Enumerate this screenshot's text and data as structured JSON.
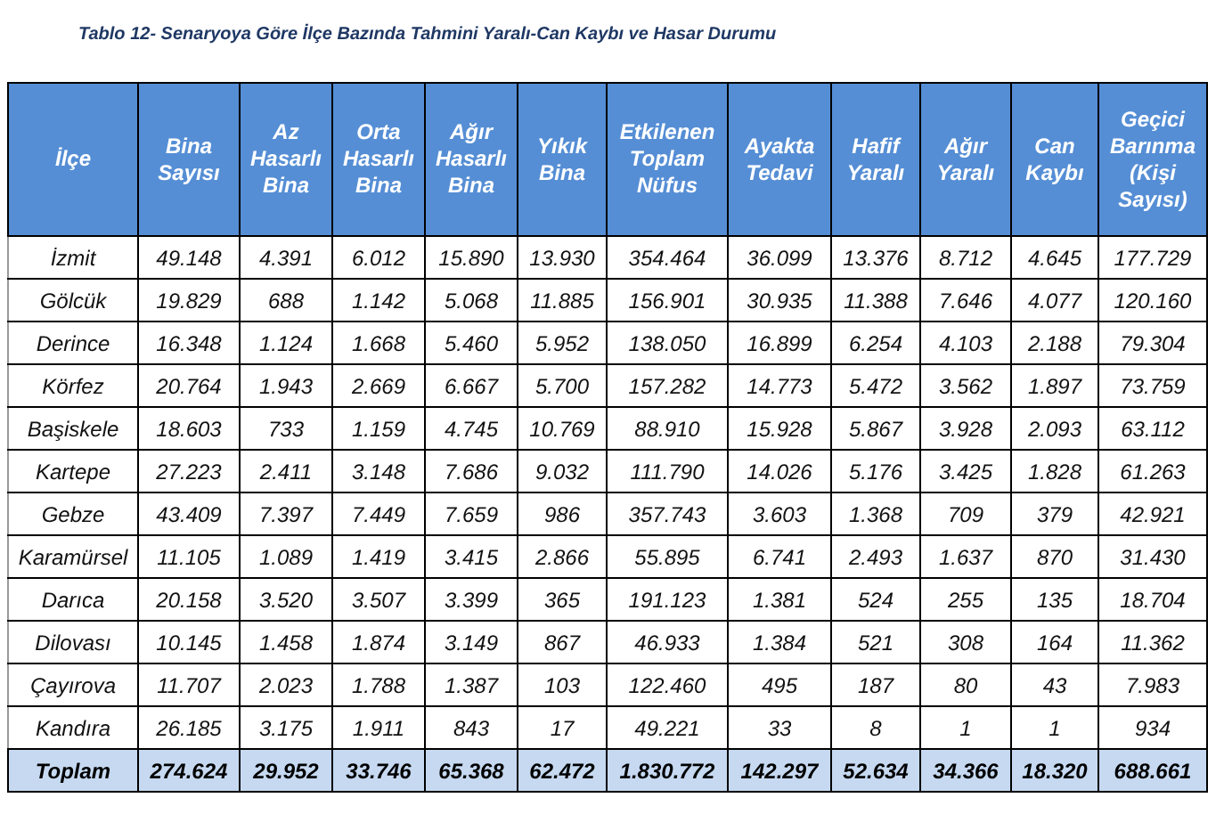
{
  "title": "Tablo 12- Senaryoya Göre İlçe Bazında Tahmini Yaralı-Can Kaybı ve Hasar Durumu",
  "table": {
    "columns": [
      {
        "label": "İlçe"
      },
      {
        "label": "Bina Sayısı"
      },
      {
        "label": "Az Hasarlı Bina"
      },
      {
        "label": "Orta Hasarlı Bina"
      },
      {
        "label": "Ağır Hasarlı Bina"
      },
      {
        "label": "Yıkık Bina"
      },
      {
        "label": "Etkilenen Toplam Nüfus"
      },
      {
        "label": "Ayakta Tedavi"
      },
      {
        "label": "Hafif Yaralı"
      },
      {
        "label": "Ağır Yaralı"
      },
      {
        "label": "Can Kaybı"
      },
      {
        "label": "Geçici Barınma (Kişi Sayısı)"
      }
    ],
    "rows": [
      {
        "kind": "data",
        "cells": [
          "İzmit",
          "49.148",
          "4.391",
          "6.012",
          "15.890",
          "13.930",
          "354.464",
          "36.099",
          "13.376",
          "8.712",
          "4.645",
          "177.729"
        ]
      },
      {
        "kind": "data",
        "cells": [
          "Gölcük",
          "19.829",
          "688",
          "1.142",
          "5.068",
          "11.885",
          "156.901",
          "30.935",
          "11.388",
          "7.646",
          "4.077",
          "120.160"
        ]
      },
      {
        "kind": "data",
        "cells": [
          "Derince",
          "16.348",
          "1.124",
          "1.668",
          "5.460",
          "5.952",
          "138.050",
          "16.899",
          "6.254",
          "4.103",
          "2.188",
          "79.304"
        ]
      },
      {
        "kind": "data",
        "cells": [
          "Körfez",
          "20.764",
          "1.943",
          "2.669",
          "6.667",
          "5.700",
          "157.282",
          "14.773",
          "5.472",
          "3.562",
          "1.897",
          "73.759"
        ]
      },
      {
        "kind": "data",
        "cells": [
          "Başiskele",
          "18.603",
          "733",
          "1.159",
          "4.745",
          "10.769",
          "88.910",
          "15.928",
          "5.867",
          "3.928",
          "2.093",
          "63.112"
        ]
      },
      {
        "kind": "data",
        "cells": [
          "Kartepe",
          "27.223",
          "2.411",
          "3.148",
          "7.686",
          "9.032",
          "111.790",
          "14.026",
          "5.176",
          "3.425",
          "1.828",
          "61.263"
        ]
      },
      {
        "kind": "data",
        "cells": [
          "Gebze",
          "43.409",
          "7.397",
          "7.449",
          "7.659",
          "986",
          "357.743",
          "3.603",
          "1.368",
          "709",
          "379",
          "42.921"
        ]
      },
      {
        "kind": "data",
        "cells": [
          "Karamürsel",
          "11.105",
          "1.089",
          "1.419",
          "3.415",
          "2.866",
          "55.895",
          "6.741",
          "2.493",
          "1.637",
          "870",
          "31.430"
        ]
      },
      {
        "kind": "data",
        "cells": [
          "Darıca",
          "20.158",
          "3.520",
          "3.507",
          "3.399",
          "365",
          "191.123",
          "1.381",
          "524",
          "255",
          "135",
          "18.704"
        ]
      },
      {
        "kind": "data",
        "cells": [
          "Dilovası",
          "10.145",
          "1.458",
          "1.874",
          "3.149",
          "867",
          "46.933",
          "1.384",
          "521",
          "308",
          "164",
          "11.362"
        ]
      },
      {
        "kind": "data",
        "cells": [
          "Çayırova",
          "11.707",
          "2.023",
          "1.788",
          "1.387",
          "103",
          "122.460",
          "495",
          "187",
          "80",
          "43",
          "7.983"
        ]
      },
      {
        "kind": "data",
        "cells": [
          "Kandıra",
          "26.185",
          "3.175",
          "1.911",
          "843",
          "17",
          "49.221",
          "33",
          "8",
          "1",
          "1",
          "934"
        ]
      },
      {
        "kind": "total",
        "cells": [
          "Toplam",
          "274.624",
          "29.952",
          "33.746",
          "65.368",
          "62.472",
          "1.830.772",
          "142.297",
          "52.634",
          "34.366",
          "18.320",
          "688.661"
        ]
      }
    ]
  }
}
